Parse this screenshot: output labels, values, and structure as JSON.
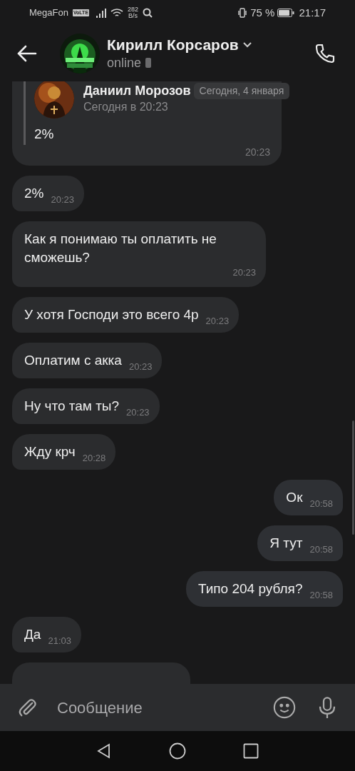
{
  "status_bar": {
    "carrier": "MegaFon",
    "volte": "VoLTE",
    "speed": "282",
    "speed_unit": "B/s",
    "battery": "75 %",
    "time": "21:17"
  },
  "header": {
    "name": "Кирилл Корсаров",
    "status": "online"
  },
  "date_chip": "Сегодня, 4 января",
  "messages": [
    {
      "kind": "quote",
      "outgoing": false,
      "author": "Даниил Морозов",
      "subtitle": "Сегодня в 20:23",
      "quoted_text": "2%",
      "time": "20:23"
    },
    {
      "kind": "text",
      "outgoing": false,
      "text": "2%",
      "time": "20:23"
    },
    {
      "kind": "text",
      "outgoing": false,
      "text": "Как я понимаю ты оплатить не сможешь?",
      "time": "20:23"
    },
    {
      "kind": "text",
      "outgoing": false,
      "text": "У хотя Господи это всего 4р",
      "time": "20:23"
    },
    {
      "kind": "text",
      "outgoing": false,
      "text": "Оплатим с акка",
      "time": "20:23"
    },
    {
      "kind": "text",
      "outgoing": false,
      "text": "Ну что там ты?",
      "time": "20:23"
    },
    {
      "kind": "text",
      "outgoing": false,
      "text": "Жду крч",
      "time": "20:28"
    },
    {
      "kind": "text",
      "outgoing": true,
      "text": "Ок",
      "time": "20:58"
    },
    {
      "kind": "text",
      "outgoing": true,
      "text": "Я тут",
      "time": "20:58"
    },
    {
      "kind": "text",
      "outgoing": true,
      "text": "Типо 204 рубля?",
      "time": "20:58"
    },
    {
      "kind": "text",
      "outgoing": false,
      "text": "Да",
      "time": "21:03"
    },
    {
      "kind": "cut"
    }
  ],
  "composer": {
    "placeholder": "Сообщение"
  }
}
